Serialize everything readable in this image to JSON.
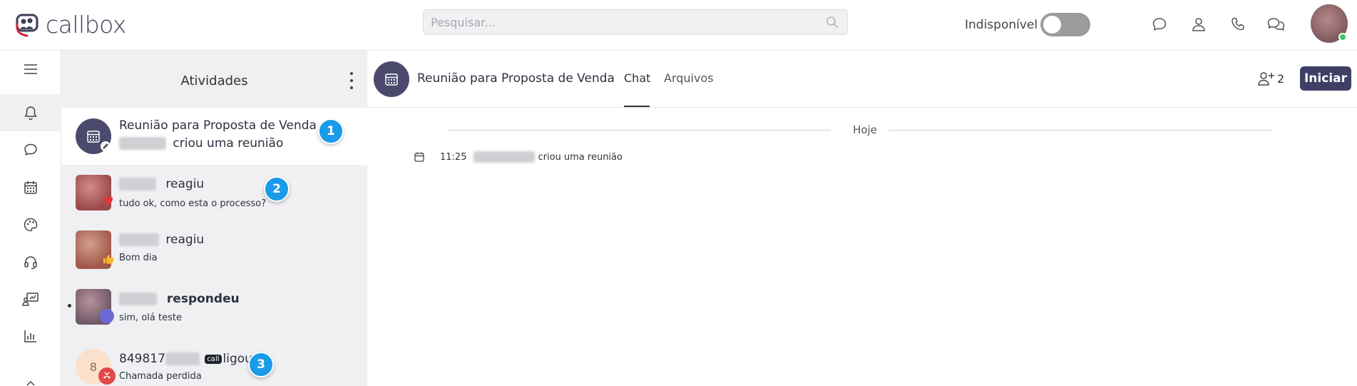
{
  "app": {
    "brand": "callbox"
  },
  "search": {
    "placeholder": "Pesquisar..."
  },
  "status": {
    "label": "Indisponível",
    "toggle_on": false
  },
  "top_icons": [
    "chat-bubble-icon",
    "user-icon",
    "phone-icon",
    "conversations-icon"
  ],
  "rail": {
    "items": [
      {
        "name": "menu-icon"
      },
      {
        "name": "bell-icon",
        "active": true
      },
      {
        "name": "chat-icon"
      },
      {
        "name": "calendar-icon"
      },
      {
        "name": "palette-icon"
      },
      {
        "name": "headset-icon"
      },
      {
        "name": "presentation-icon"
      },
      {
        "name": "bar-chart-icon"
      }
    ]
  },
  "activities": {
    "title": "Atividades",
    "items": [
      {
        "line1": "Reunião para Proposta de Venda",
        "line2_action": "criou uma reunião",
        "marker": "1"
      },
      {
        "action": "reagiu",
        "message": "tudo ok, como esta o processo?",
        "marker": "2"
      },
      {
        "action": "reagiu",
        "message": "Bom dia"
      },
      {
        "action": "respondeu",
        "message": "sim, olá teste"
      },
      {
        "phone_prefix": "849817",
        "call_tag": "call",
        "action": "ligou",
        "message": "Chamada perdida",
        "avatar_initial": "8",
        "marker": "3"
      }
    ]
  },
  "chat": {
    "title": "Reunião para Proposta de Venda",
    "tabs": [
      "Chat",
      "Arquivos"
    ],
    "active_tab": "Chat",
    "participants_count": "2",
    "start_label": "Iniciar",
    "day_label": "Hoje",
    "messages": [
      {
        "time": "11:25",
        "text": "criou uma reunião"
      }
    ]
  },
  "colors": {
    "accent": "#3f3f66",
    "marker": "#1a9bea",
    "panel_bg": "#f0f0f2",
    "online": "#3ec46b"
  }
}
